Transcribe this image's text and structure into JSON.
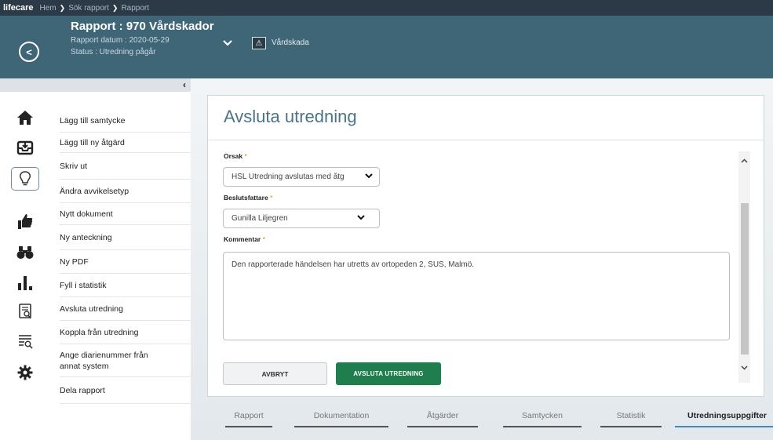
{
  "topbar": {
    "brand": "lifecare",
    "breadcrumbs": [
      "Hem",
      "Sök rapport",
      "Rapport"
    ]
  },
  "header": {
    "title": "Rapport : 970 Vårdskador",
    "date": "Rapport datum : 2020-05-29",
    "status": "Status : Utredning pågår",
    "type_label": "Vårdskada"
  },
  "sidebar": {
    "icons": [
      "home-icon",
      "inbox-icon",
      "lightbulb-icon",
      "thumbs-up-icon",
      "binoculars-icon",
      "bar-chart-icon",
      "document-search-icon",
      "list-search-icon",
      "gear-icon"
    ],
    "actions": [
      "Lägg till samtycke",
      "Lägg till ny åtgärd",
      "Skriv ut",
      "Ändra avvikelsetyp",
      "Nytt dokument",
      "Ny anteckning",
      "Ny PDF",
      "Fyll i statistik",
      "Avsluta utredning",
      "Koppla från utredning",
      "Ange diarienummer från annat system",
      "Dela rapport"
    ]
  },
  "form": {
    "title": "Avsluta utredning",
    "orsak_label": "Orsak",
    "orsak_value": "HSL Utredning avslutas med åtg",
    "beslut_label": "Beslutsfattare",
    "beslut_value": "Gunilla Liljegren",
    "kommentar_label": "Kommentar",
    "kommentar_value": "Den rapporterade händelsen har utretts av ortopeden 2, SUS, Malmö.",
    "required_mark": "*",
    "cancel_label": "AVBRYT",
    "submit_label": "AVSLUTA UTREDNING"
  },
  "tabs": [
    "Rapport",
    "Dokumentation",
    "Åtgärder",
    "Samtycken",
    "Statistik",
    "Utredningsuppgifter"
  ],
  "colors": {
    "header_bg": "#3f6677",
    "topbar_bg": "#2b3a46",
    "primary_button": "#1f7e4d",
    "title_color": "#4b7486",
    "required_color": "#e8a94c",
    "active_tab": "#3f8db8"
  }
}
